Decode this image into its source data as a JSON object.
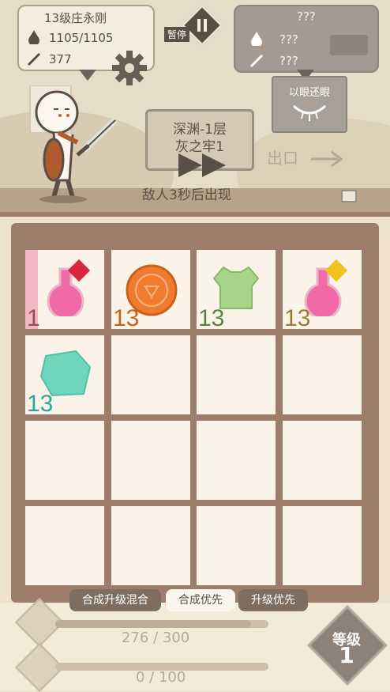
{
  "hero": {
    "name": "13级庄永刚",
    "hp": "1105/1105",
    "atk": "377"
  },
  "enemy": {
    "name": "???",
    "hp": "???",
    "atk": "???",
    "card_label": "以眼还眼"
  },
  "pause": {
    "label": "暂停"
  },
  "stage": {
    "title": "深渊-1层",
    "subtitle": "灰之牢1",
    "status": "敌人3秒后出现",
    "exit_label": "出口"
  },
  "grid": {
    "items": [
      {
        "name": "red-potion",
        "qty": "1",
        "color": "#9b4b57"
      },
      {
        "name": "orange-coin",
        "qty": "13",
        "color": "#c8621a"
      },
      {
        "name": "green-armor",
        "qty": "13",
        "color": "#5d7f4a"
      },
      {
        "name": "yellow-potion",
        "qty": "13",
        "color": "#9b7c3a"
      },
      {
        "name": "teal-gem",
        "qty": "13",
        "color": "#2aa69a"
      }
    ]
  },
  "tabs": [
    {
      "label": "合成升级混合",
      "active": false
    },
    {
      "label": "合成优先",
      "active": true
    },
    {
      "label": "升级优先",
      "active": false
    }
  ],
  "progress": {
    "exp": "276 / 300",
    "exp_fraction": 0.92,
    "secondary": "0 / 100",
    "secondary_fraction": 0
  },
  "level": {
    "label": "等级",
    "value": "1"
  }
}
